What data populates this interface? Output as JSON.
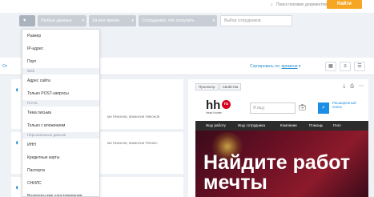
{
  "topbar": {
    "search_text": "Поиск похожих документов",
    "find_label": "Найти"
  },
  "filters": {
    "filter_icon_label": "▼",
    "buttons": [
      "Любые данные",
      "За все время",
      "Сотрудники, что получить"
    ],
    "employee_placeholder": "Выбор сотрудников"
  },
  "content_bar": {
    "left_text": "От",
    "sort_label": "Сортировать по:",
    "sort_value": "времени"
  },
  "cards": [
    {
      "text": "ми Никонов, вакансии Никонов"
    },
    {
      "text": "ми Никонов, вакансии Пленкс"
    }
  ],
  "preview": {
    "tabs": [
      "Просмотр",
      "Свойства"
    ],
    "site": {
      "logo": "hh",
      "logo_badge": "ru",
      "tagline": "Head Hunter",
      "search_placeholder": "Я ищу",
      "advanced": [
        "Расширенный",
        "поиск"
      ],
      "nav": [
        "Ищу работу",
        "Ищу сотрудника",
        "Компании",
        "Помощь",
        "Геол"
      ],
      "headline": [
        "Найдите работ",
        "мечты"
      ]
    }
  },
  "dropdown": {
    "items": [
      {
        "type": "item",
        "label": "Размер"
      },
      {
        "type": "item",
        "label": "IP-адрес"
      },
      {
        "type": "item",
        "label": "Порт"
      },
      {
        "type": "section",
        "label": "Web"
      },
      {
        "type": "item",
        "label": "Адрес сайта"
      },
      {
        "type": "item",
        "label": "Только POST-запросы"
      },
      {
        "type": "section",
        "label": "Почта"
      },
      {
        "type": "item",
        "label": "Тема письма"
      },
      {
        "type": "item",
        "label": "Только с вложением"
      },
      {
        "type": "section",
        "label": "Персональные данные"
      },
      {
        "type": "item",
        "label": "ИНН"
      },
      {
        "type": "item",
        "label": "Кредитные карты"
      },
      {
        "type": "item",
        "label": "Паспорта"
      },
      {
        "type": "item",
        "label": "СНИЛС"
      },
      {
        "type": "item",
        "label": "Водительские удостоверения"
      }
    ]
  },
  "colors": {
    "accent": "#2e8ece",
    "find_button": "#f6a623",
    "filter_button": "#c9ced6",
    "hh_red": "#d6001c",
    "hh_blue": "#1b8ee5"
  }
}
